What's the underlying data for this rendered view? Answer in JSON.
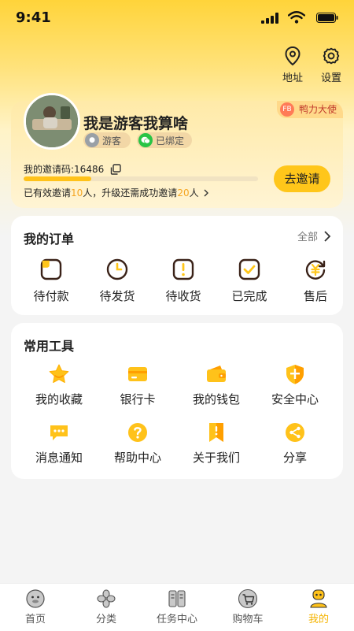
{
  "status_bar": {
    "time": "9:41"
  },
  "top_actions": {
    "address": "地址",
    "settings": "设置"
  },
  "profile": {
    "username": "我是游客我算啥",
    "tag_guest": "游客",
    "tag_bound": "已绑定",
    "ambassador": "鸭力大使",
    "ambassador_badge": "FB",
    "invite_code_label": "我的邀请码:16486",
    "invite_progress": 0.29,
    "invite_hint_prefix": "已有效邀请",
    "invite_hint_count": "10",
    "invite_hint_middle": "人，升级还需成功邀请",
    "invite_hint_need": "20",
    "invite_hint_suffix": "人",
    "invite_button": "去邀请"
  },
  "orders": {
    "title": "我的订单",
    "all_label": "全部",
    "items": [
      {
        "label": "待付款",
        "icon": "pending-payment-icon"
      },
      {
        "label": "待发货",
        "icon": "pending-shipment-icon"
      },
      {
        "label": "待收货",
        "icon": "pending-receipt-icon"
      },
      {
        "label": "已完成",
        "icon": "completed-icon"
      },
      {
        "label": "售后",
        "icon": "after-sales-icon"
      }
    ]
  },
  "tools": {
    "title": "常用工具",
    "items": [
      {
        "label": "我的收藏",
        "icon": "star-icon"
      },
      {
        "label": "银行卡",
        "icon": "bank-card-icon"
      },
      {
        "label": "我的钱包",
        "icon": "wallet-icon"
      },
      {
        "label": "安全中心",
        "icon": "shield-icon"
      },
      {
        "label": "消息通知",
        "icon": "message-icon"
      },
      {
        "label": "帮助中心",
        "icon": "help-icon"
      },
      {
        "label": "关于我们",
        "icon": "bookmark-icon"
      },
      {
        "label": "分享",
        "icon": "share-icon"
      }
    ]
  },
  "bottom_nav": {
    "items": [
      {
        "label": "首页",
        "icon": "home-icon"
      },
      {
        "label": "分类",
        "icon": "category-icon"
      },
      {
        "label": "任务中心",
        "icon": "task-center-icon"
      },
      {
        "label": "购物车",
        "icon": "cart-icon"
      },
      {
        "label": "我的",
        "icon": "profile-icon"
      }
    ],
    "active_index": 4
  },
  "colors": {
    "accent": "#ffc61a",
    "highlight": "#f5a623",
    "dark": "#3a2218"
  }
}
